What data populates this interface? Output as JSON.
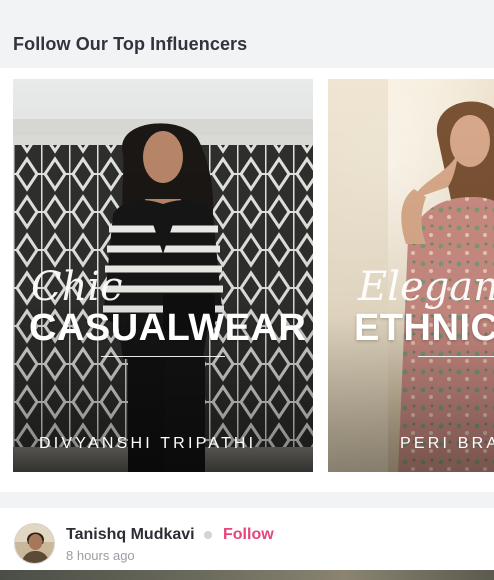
{
  "section": {
    "title": "Follow Our Top Influencers"
  },
  "influencers": [
    {
      "script_word": "Chic",
      "category": "CASUALWEAR",
      "name_caption": "DIVYANSHI TRIPATHI"
    },
    {
      "script_word": "Elegant",
      "category": "ETHNICWEAR",
      "name_caption": "PERI BRAHMA"
    }
  ],
  "post": {
    "author": "Tanishq Mudkavi",
    "follow_label": "Follow",
    "time": "8 hours ago"
  },
  "colors": {
    "follow_accent": "#e5457a",
    "background_gray": "#f2f3f5"
  }
}
